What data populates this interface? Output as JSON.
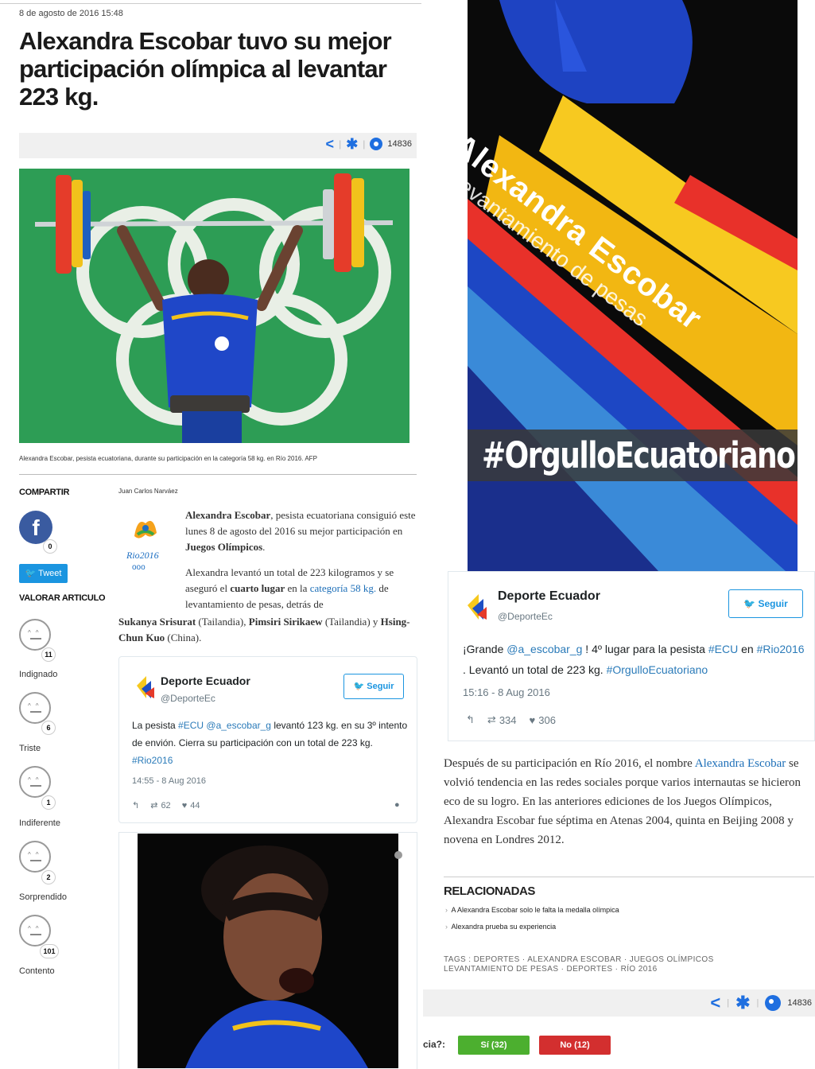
{
  "article": {
    "date": "8 de agosto de 2016 15:48",
    "headline": "Alexandra Escobar tuvo su mejor participación olímpica al levantar 223 kg.",
    "views": "14836",
    "photo_caption": "Alexandra Escobar, pesista ecuatoriana, durante su participación en la categoría 58 kg. en Río 2016. AFP",
    "author": "Juan Carlos Narváez",
    "p1": {
      "bold": "Alexandra Escobar",
      "text": ", pesista ecuatoriana consiguió este lunes 8 de agosto del 2016 su mejor participación en ",
      "bold2": "Juegos Olímpicos",
      "end": "."
    },
    "p2": {
      "t1": "Alexandra levantó un total de 223 kilogramos y se aseguró el ",
      "b1": "cuarto lugar",
      "t2": " en la ",
      "link": "categoría 58 kg.",
      "t3": " de levantamiento de pesas, detrás de ",
      "b2": "Sukanya Srisurat",
      "t4": " (Tailandia), ",
      "b3": "Pimsiri Sirikaew",
      "t5": " (Tailandia) y ",
      "b4": "Hsing-Chun Kuo",
      "t6": " (China)."
    },
    "p3": {
      "t1": "Después de su participación en Río 2016, el nombre ",
      "link": "Alexandra Escobar",
      "t2": " se volvió tendencia en las redes sociales porque varios internautas se hicieron eco de su logro. En las anteriores ediciones de los Juegos Olímpicos, Alexandra Escobar fue séptima en Atenas 2004, quinta en Beijing 2008 y novena en Londres 2012."
    }
  },
  "sidebar": {
    "share_heading": "COMPARTIR",
    "fb_count": "0",
    "tweet_label": "Tweet",
    "rate_heading": "VALORAR ARTICULO",
    "reactions": [
      {
        "label": "Indignado",
        "count": "11"
      },
      {
        "label": "Triste",
        "count": "6"
      },
      {
        "label": "Indiferente",
        "count": "1"
      },
      {
        "label": "Sorprendido",
        "count": "2"
      },
      {
        "label": "Contento",
        "count": "101"
      }
    ]
  },
  "logo": {
    "text": "Rio2016"
  },
  "tweet1": {
    "name": "Deporte Ecuador",
    "handle": "@DeporteEc",
    "follow": "Seguir",
    "text_a": "La pesista ",
    "tag1": "#ECU",
    "mention": "@a_escobar_g",
    "text_b": " levantó 123 kg. en su 3º intento de envión. Cierra su participación con un total de 223 kg. ",
    "tag2": "#Rio2016",
    "time": "14:55 - 8 Aug 2016",
    "retweets": "62",
    "likes": "44"
  },
  "poster": {
    "name": "Alexandra Escobar",
    "sub": "Levantamiento de pesas",
    "hashtag": "#OrgulloEcuatoriano"
  },
  "tweet2": {
    "name": "Deporte Ecuador",
    "handle": "@DeporteEc",
    "follow": "Seguir",
    "text_a": "¡Grande ",
    "mention": "@a_escobar_g",
    "text_b": " ! 4º lugar para la pesista ",
    "tag1": "#ECU",
    "text_c": " en ",
    "tag2": "#Rio2016",
    "text_d": " . Levantó un total de 223 kg. ",
    "tag3": "#OrgulloEcuatoriano",
    "time": "15:16 - 8 Aug 2016",
    "retweets": "334",
    "likes": "306"
  },
  "related": {
    "heading": "RELACIONADAS",
    "items": [
      "A Alexandra Escobar solo le falta la medalla olímpica",
      "Alexandra prueba su experiencia"
    ]
  },
  "tags": {
    "label": "TAGS",
    "line1": "DEPORTES · ALEXANDRA ESCOBAR · JUEGOS OLÍMPICOS",
    "line2": "LEVANTAMIENTO DE PESAS · DEPORTES · RÍO 2016"
  },
  "bottom_share": {
    "views": "14836"
  },
  "poll": {
    "question": "cia?:",
    "yes": "Sí (32)",
    "no": "No (12)"
  },
  "colors": {
    "accent_blue": "#1f6fe0",
    "twitter": "#1b95e0",
    "poll_yes": "#4caf2f",
    "poll_no": "#d32f2f"
  }
}
